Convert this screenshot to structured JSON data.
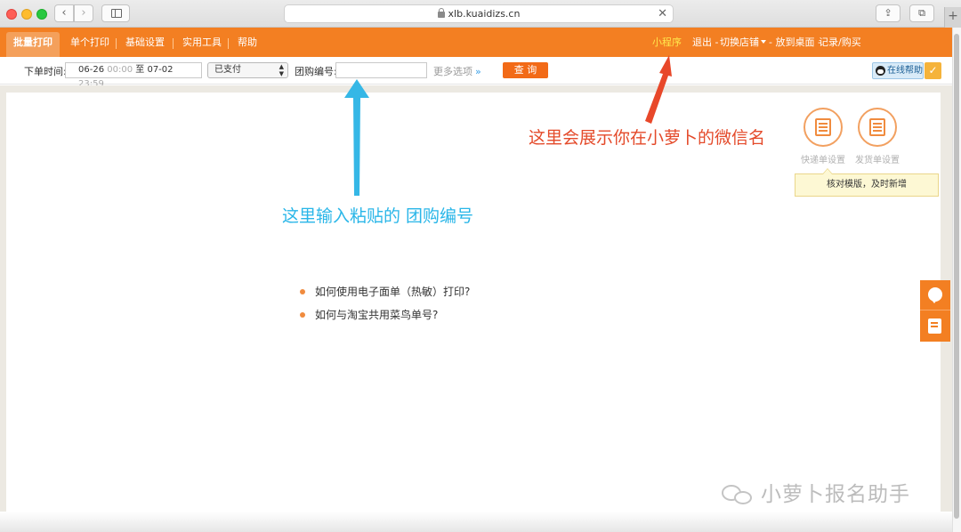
{
  "browser": {
    "url": "xlb.kuaidizs.cn",
    "back_glyph": "‹",
    "forward_glyph": "›",
    "share_glyph": "⇪",
    "tabs_glyph": "⧉",
    "close_glyph": "✕",
    "newtab_glyph": "+"
  },
  "topnav": {
    "tabs": [
      {
        "label": "批量打印",
        "active": true
      },
      {
        "label": "单个打印"
      },
      {
        "label": "基础设置"
      },
      {
        "label": "实用工具"
      },
      {
        "label": "帮助"
      }
    ],
    "miniprogram": "小程序",
    "logout": "退出 -",
    "switch_store": "切换店铺",
    "put_desktop": "- 放到桌面 -",
    "records": "记录/购买"
  },
  "filter": {
    "order_time_label": "下单时间:",
    "date_from": "06-26",
    "time_from": "00:00",
    "date_to_sep": "至",
    "date_to": "07-02",
    "time_to": "23:59",
    "status_value": "已支付",
    "group_no_label": "团购编号:",
    "group_no_value": "",
    "more_options": "更多选项",
    "more_icon": "»",
    "query_button": "查 询",
    "online_help": "在线帮助",
    "check_icon": "✓"
  },
  "shortcuts": [
    {
      "label": "快递单设置",
      "icon": "express-template-icon"
    },
    {
      "label": "发货单设置",
      "icon": "invoice-template-icon"
    }
  ],
  "tooltip": "核对模版，及时新增",
  "annotations": {
    "red": "这里会展示你在小萝卜的微信名",
    "blue": "这里输入粘贴的 团购编号"
  },
  "tips": [
    "如何使用电子面单（热敏）打印?",
    "如何与淘宝共用菜鸟单号?"
  ],
  "watermark": "小萝卜报名助手",
  "colors": {
    "brand_orange": "#f37f22",
    "annotation_red": "#e44a2a",
    "annotation_blue": "#29b6e8"
  }
}
